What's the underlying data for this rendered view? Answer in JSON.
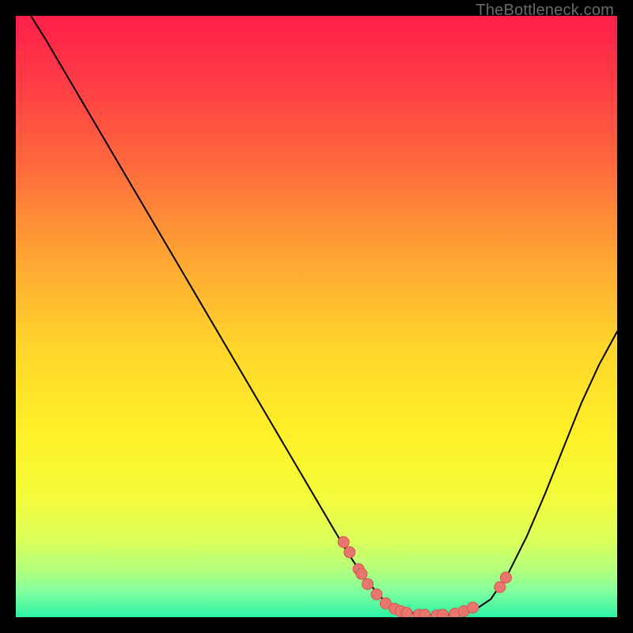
{
  "attribution": "TheBottleneck.com",
  "chart_data": {
    "type": "line",
    "title": "",
    "xlabel": "",
    "ylabel": "",
    "xlim": [
      0,
      100
    ],
    "ylim": [
      0,
      100
    ],
    "grid": false,
    "legend": false,
    "background_gradient_stops": [
      {
        "offset": 0.0,
        "color": "#ff1f49"
      },
      {
        "offset": 0.1,
        "color": "#ff3846"
      },
      {
        "offset": 0.25,
        "color": "#ff6a3c"
      },
      {
        "offset": 0.4,
        "color": "#ffa433"
      },
      {
        "offset": 0.55,
        "color": "#ffd52b"
      },
      {
        "offset": 0.7,
        "color": "#fff128"
      },
      {
        "offset": 0.8,
        "color": "#f4fb3a"
      },
      {
        "offset": 0.87,
        "color": "#dcff59"
      },
      {
        "offset": 0.92,
        "color": "#b4ff7a"
      },
      {
        "offset": 0.96,
        "color": "#7dffa0"
      },
      {
        "offset": 1.0,
        "color": "#29f3a2"
      }
    ],
    "series": [
      {
        "name": "bottleneck-curve",
        "stroke": "#000000",
        "stroke_width": 2,
        "x": [
          0.0,
          5.0,
          10.0,
          15.0,
          20.0,
          25.0,
          30.0,
          35.0,
          40.0,
          45.0,
          50.0,
          55.0,
          58.0,
          61.0,
          64.0,
          67.0,
          70.0,
          73.0,
          76.0,
          79.0,
          82.0,
          85.0,
          88.0,
          91.0,
          94.0,
          97.0,
          100.0
        ],
        "values": [
          104.0,
          96.0,
          87.5,
          79.0,
          70.5,
          62.0,
          53.5,
          45.0,
          36.5,
          28.0,
          19.5,
          11.0,
          6.5,
          3.0,
          1.2,
          0.5,
          0.3,
          0.4,
          1.0,
          3.0,
          7.5,
          13.5,
          20.5,
          28.0,
          35.5,
          42.0,
          47.5
        ]
      }
    ],
    "scatter": {
      "name": "sample-points",
      "fill": "#e9766e",
      "stroke": "#d4574f",
      "radius": 7,
      "x": [
        54.5,
        55.5,
        57.0,
        57.5,
        58.5,
        60.0,
        61.5,
        63.0,
        64.0,
        65.0,
        67.0,
        68.0,
        70.0,
        71.0,
        73.0,
        74.5,
        76.0,
        80.5,
        81.5
      ],
      "values": [
        12.5,
        10.8,
        8.0,
        7.2,
        5.5,
        3.8,
        2.3,
        1.4,
        1.0,
        0.7,
        0.4,
        0.4,
        0.3,
        0.4,
        0.6,
        1.0,
        1.6,
        5.0,
        6.6
      ]
    }
  }
}
